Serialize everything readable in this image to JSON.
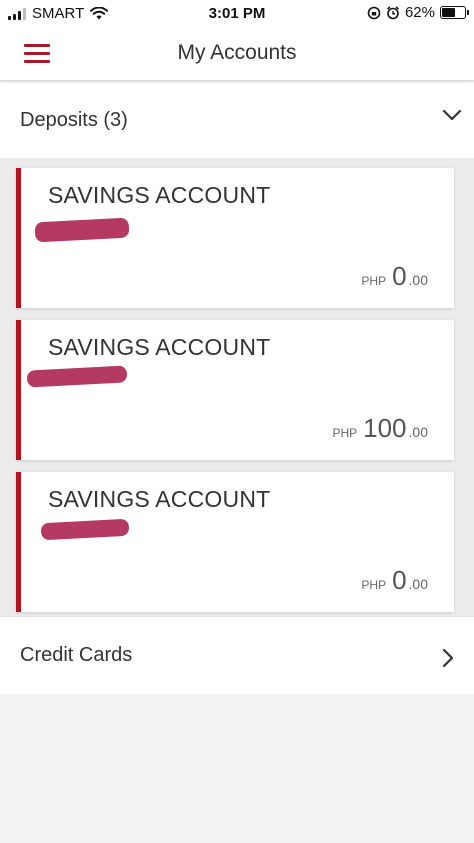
{
  "status_bar": {
    "carrier": "SMART",
    "time": "3:01 PM",
    "battery_percent": "62%",
    "battery_level": 0.62,
    "icons": [
      "signal-icon",
      "wifi-icon",
      "lock-rotation-icon",
      "alarm-icon",
      "battery-icon"
    ]
  },
  "nav": {
    "title": "My Accounts",
    "menu_icon": "hamburger-menu-icon"
  },
  "deposits": {
    "label": "Deposits (3)",
    "chevron_icon": "chevron-down-icon",
    "accounts": [
      {
        "title": "SAVINGS ACCOUNT",
        "currency": "PHP",
        "amount": "0",
        "decimals": ".00"
      },
      {
        "title": "SAVINGS ACCOUNT",
        "currency": "PHP",
        "amount": "100",
        "decimals": ".00"
      },
      {
        "title": "SAVINGS ACCOUNT",
        "currency": "PHP",
        "amount": "0",
        "decimals": ".00"
      }
    ]
  },
  "credit_cards": {
    "label": "Credit Cards",
    "chevron_icon": "chevron-right-icon"
  },
  "colors": {
    "brand_red": "#b3131f",
    "redaction": "#b43a64"
  }
}
